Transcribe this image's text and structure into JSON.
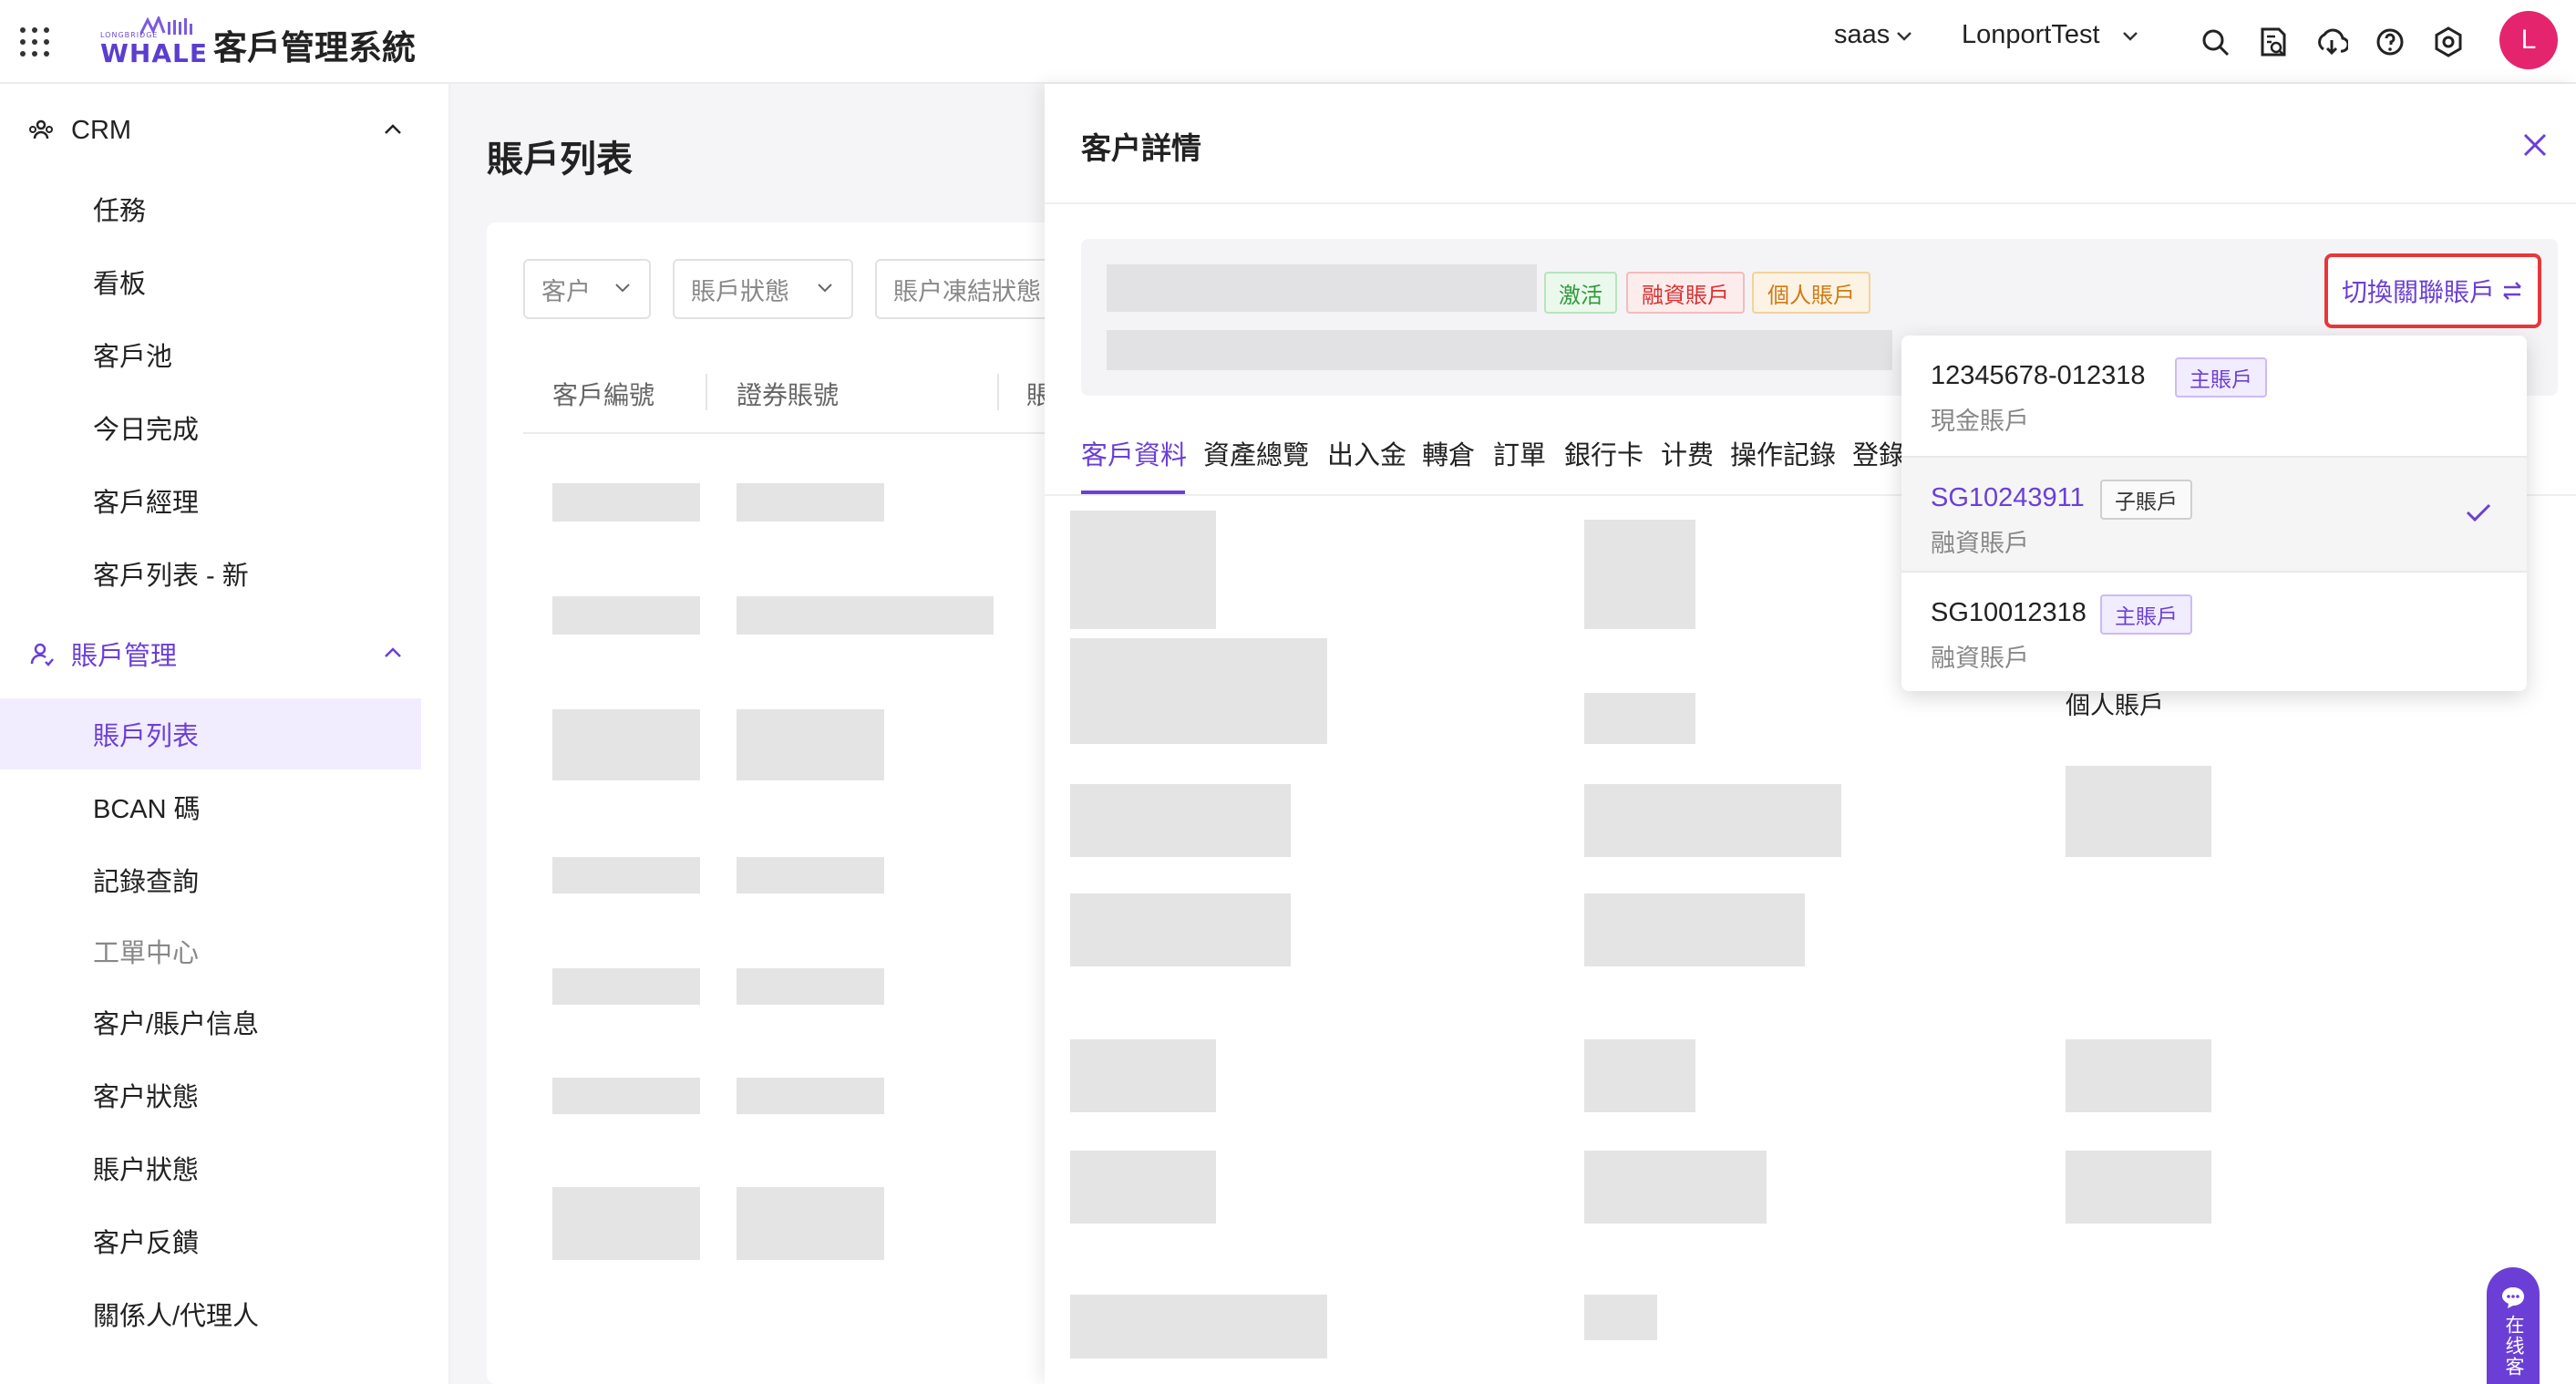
{
  "header": {
    "logo_small": "LONGBRIDGE",
    "logo_main": "WHALE",
    "app_title": "客戶管理系統",
    "tenant": "saas",
    "account": "LonportTest",
    "avatar_letter": "L"
  },
  "sidebar": {
    "crm": "CRM",
    "crm_items": [
      "任務",
      "看板",
      "客戶池",
      "今日完成",
      "客戶經理",
      "客戶列表 - 新"
    ],
    "account_mgmt": "賬戶管理",
    "account_items": [
      "賬戶列表",
      "BCAN 碼",
      "記錄查詢"
    ],
    "ticket_center": "工單中心",
    "ticket_items": [
      "客户/賬户信息",
      "客户狀態",
      "賬户狀態",
      "客户反饋",
      "關係人/代理人"
    ]
  },
  "main": {
    "page_title": "賬戶列表",
    "filters": [
      "客户",
      "賬戶狀態",
      "賬户凍結狀態"
    ],
    "columns": [
      "客戶編號",
      "證券賬號",
      "賬"
    ]
  },
  "drawer": {
    "title": "客户詳情",
    "tags": [
      "激活",
      "融資賬戶",
      "個人賬戶"
    ],
    "switch_label": "切換關聯賬戶",
    "tabs": [
      "客戶資料",
      "資產總覽",
      "出入金",
      "轉倉",
      "訂單",
      "銀行卡",
      "计费",
      "操作記錄",
      "登錄"
    ],
    "visible_value": "個人賬戶"
  },
  "dropdown": {
    "items": [
      {
        "account": "12345678-012318",
        "badge": "主賬戶",
        "type": "現金賬戶",
        "selected": false
      },
      {
        "account": "SG10243911",
        "badge": "子賬戶",
        "type": "融資賬戶",
        "selected": true
      },
      {
        "account": "SG10012318",
        "badge": "主賬戶",
        "type": "融資賬戶",
        "selected": false
      }
    ]
  },
  "chat": {
    "label": "在线客"
  },
  "colors": {
    "accent": "#6b3fd6",
    "highlight_border": "#e8373a",
    "avatar": "#e5246e"
  }
}
